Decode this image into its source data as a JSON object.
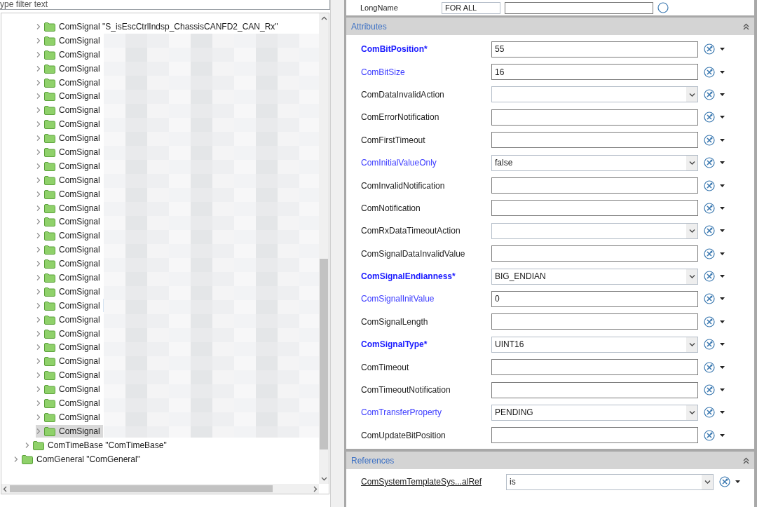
{
  "filter": {
    "placeholder": "ype filter text"
  },
  "tree": [
    {
      "label": "ComSignal",
      "name": "\"S_isEscCtrlIndsp_ChassisCANFD2_CAN_Rx\"",
      "selected": false,
      "hovered": false
    },
    {
      "label": "ComSignal",
      "selected": false,
      "hovered": false
    },
    {
      "label": "ComSignal",
      "selected": false,
      "hovered": false
    },
    {
      "label": "ComSignal",
      "selected": false,
      "hovered": false
    },
    {
      "label": "ComSignal",
      "selected": false,
      "hovered": false
    },
    {
      "label": "ComSignal",
      "selected": false,
      "hovered": false
    },
    {
      "label": "ComSignal",
      "selected": false,
      "hovered": false
    },
    {
      "label": "ComSignal",
      "selected": false,
      "hovered": false
    },
    {
      "label": "ComSignal",
      "selected": false,
      "hovered": false
    },
    {
      "label": "ComSignal",
      "selected": false,
      "hovered": false
    },
    {
      "label": "ComSignal",
      "selected": false,
      "hovered": false
    },
    {
      "label": "ComSignal",
      "selected": false,
      "hovered": false
    },
    {
      "label": "ComSignal",
      "selected": false,
      "hovered": false
    },
    {
      "label": "ComSignal",
      "selected": false,
      "hovered": false
    },
    {
      "label": "ComSignal",
      "selected": false,
      "hovered": false
    },
    {
      "label": "ComSignal",
      "selected": false,
      "hovered": false
    },
    {
      "label": "ComSignal",
      "selected": false,
      "hovered": false
    },
    {
      "label": "ComSignal",
      "selected": false,
      "hovered": false
    },
    {
      "label": "ComSignal",
      "selected": false,
      "hovered": false
    },
    {
      "label": "ComSignal",
      "selected": false,
      "hovered": false
    },
    {
      "label": "ComSignal",
      "selected": false,
      "hovered": true
    },
    {
      "label": "ComSignal",
      "selected": false,
      "hovered": false
    },
    {
      "label": "ComSignal",
      "selected": false,
      "hovered": false
    },
    {
      "label": "ComSignal",
      "selected": false,
      "hovered": false
    },
    {
      "label": "ComSignal",
      "selected": false,
      "hovered": false
    },
    {
      "label": "ComSignal",
      "selected": false,
      "hovered": false
    },
    {
      "label": "ComSignal",
      "selected": false,
      "hovered": false
    },
    {
      "label": "ComSignal",
      "selected": false,
      "hovered": false
    },
    {
      "label": "ComSignal",
      "selected": false,
      "hovered": false
    },
    {
      "label": "ComSignal",
      "selected": true,
      "hovered": false
    }
  ],
  "tree_after": [
    {
      "label": "ComTimeBase \"ComTimeBase\"",
      "kind": "parent"
    },
    {
      "label": "ComGeneral \"ComGeneral\"",
      "kind": "root"
    }
  ],
  "longname": {
    "label": "LongName",
    "language": "FOR ALL"
  },
  "attributes": {
    "title": "Attributes",
    "rows": [
      {
        "label": "ComBitPosition*",
        "required": true,
        "configured": true,
        "kind": "text",
        "value": "55"
      },
      {
        "label": "ComBitSize",
        "required": false,
        "configured": true,
        "kind": "text",
        "value": "16"
      },
      {
        "label": "ComDataInvalidAction",
        "required": false,
        "configured": false,
        "kind": "combo"
      },
      {
        "label": "ComErrorNotification",
        "required": false,
        "configured": false,
        "kind": "text"
      },
      {
        "label": "ComFirstTimeout",
        "required": false,
        "configured": false,
        "kind": "text"
      },
      {
        "label": "ComInitialValueOnly",
        "required": false,
        "configured": true,
        "kind": "combo",
        "value": "false"
      },
      {
        "label": "ComInvalidNotification",
        "required": false,
        "configured": false,
        "kind": "text"
      },
      {
        "label": "ComNotification",
        "required": false,
        "configured": false,
        "kind": "text"
      },
      {
        "label": "ComRxDataTimeoutAction",
        "required": false,
        "configured": false,
        "kind": "combo"
      },
      {
        "label": "ComSignalDataInvalidValue",
        "required": false,
        "configured": false,
        "kind": "text"
      },
      {
        "label": "ComSignalEndianness*",
        "required": true,
        "configured": true,
        "kind": "combo",
        "value": "BIG_ENDIAN"
      },
      {
        "label": "ComSignalInitValue",
        "required": false,
        "configured": true,
        "kind": "text",
        "value": "0"
      },
      {
        "label": "ComSignalLength",
        "required": false,
        "configured": false,
        "kind": "text"
      },
      {
        "label": "ComSignalType*",
        "required": true,
        "configured": true,
        "kind": "combo",
        "value": "UINT16"
      },
      {
        "label": "ComTimeout",
        "required": false,
        "configured": false,
        "kind": "text"
      },
      {
        "label": "ComTimeoutNotification",
        "required": false,
        "configured": false,
        "kind": "text"
      },
      {
        "label": "ComTransferProperty",
        "required": false,
        "configured": true,
        "kind": "combo",
        "value": "PENDING"
      },
      {
        "label": "ComUpdateBitPosition",
        "required": false,
        "configured": false,
        "kind": "text"
      }
    ]
  },
  "references": {
    "title": "References",
    "rows": [
      {
        "label": "ComSystemTemplateSys...alRef",
        "value": "is"
      }
    ]
  }
}
